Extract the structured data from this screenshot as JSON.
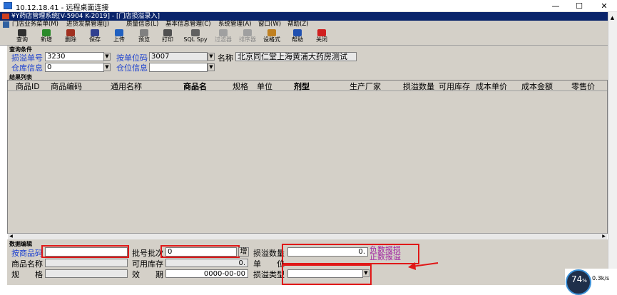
{
  "remote_window": {
    "title": "10.12.18.41 - 远程桌面连接",
    "controls": [
      "—",
      "☐",
      "✕"
    ]
  },
  "app": {
    "title": "¥Y药店管理系统[V-5904 K-2019] - [门店损溢录入]"
  },
  "menu": [
    "门店业务菜单(M)",
    "进货发票管理(J)",
    "质量信息(L)",
    "基本信息管理(C)",
    "系统管理(A)",
    "窗口(W)",
    "帮助(Z)"
  ],
  "toolbar": [
    {
      "label": "查询",
      "icon": "binoculars-icon",
      "color": "#303030"
    },
    {
      "label": "新增",
      "icon": "add-icon",
      "color": "#2a8a2a"
    },
    {
      "label": "删除",
      "icon": "delete-icon",
      "color": "#a03020"
    },
    {
      "label": "保存",
      "icon": "save-icon",
      "color": "#304090"
    },
    {
      "label": "上传",
      "icon": "upload-icon",
      "color": "#2060c0"
    },
    {
      "label": "预览",
      "icon": "preview-icon",
      "color": "#808080"
    },
    {
      "label": "打印",
      "icon": "printer-icon",
      "color": "#505050"
    },
    {
      "label": "SQL Spy",
      "icon": "sql-icon",
      "color": "#606060"
    },
    {
      "label": "过滤器",
      "icon": "filter-icon",
      "color": "#a0a0a0",
      "disabled": true
    },
    {
      "label": "排序器",
      "icon": "sort-icon",
      "color": "#a0a0a0",
      "disabled": true
    },
    {
      "label": "设格式",
      "icon": "format-icon",
      "color": "#c08020"
    },
    {
      "label": "帮助",
      "icon": "help-icon",
      "color": "#2050b0"
    },
    {
      "label": "关闭",
      "icon": "close-app-icon",
      "color": "#d02020"
    }
  ],
  "query": {
    "section_title": "查询条件",
    "loss_no_label": "损溢单号",
    "loss_no_value": "3230",
    "unit_code_label": "按单位码",
    "unit_code_value": "3007",
    "name_label": "名称",
    "name_value": "北京同仁堂上海黄浦大药房测试",
    "warehouse_label": "仓库信息",
    "warehouse_value": "0",
    "location_label": "仓位信息",
    "location_value": ""
  },
  "results": {
    "section_title": "结果列表",
    "columns": [
      "商品ID",
      "商品编码",
      "通用名称",
      "商品名",
      "规格",
      "单位",
      "剂型",
      "生产厂家",
      "损溢数量",
      "可用库存",
      "成本单价",
      "成本金额",
      "零售价"
    ]
  },
  "edit": {
    "section_title": "数据编辑",
    "product_code_label": "按商品码",
    "product_code_value": "",
    "batch_label": "批号批次",
    "batch_value": "0",
    "add_button": "增",
    "loss_qty_label": "损溢数量",
    "loss_qty_value": "0.",
    "negative_note": "负数报损",
    "positive_note": "正数报溢",
    "product_name_label": "商品名称",
    "stock_label": "可用库存",
    "stock_value": "0.",
    "unit_label": "单　　位",
    "spec_label": "规　　格",
    "validity_label": "效　　期",
    "validity_value": "0000-00-00",
    "loss_type_label": "损溢类型"
  },
  "taskbar": {
    "percent": "74",
    "percent_sign": "%",
    "speed": "0.3k/s"
  },
  "colors": {
    "label_blue": "#1a3fd0",
    "note_purple": "#a020a0",
    "highlight_red": "#e01818"
  }
}
